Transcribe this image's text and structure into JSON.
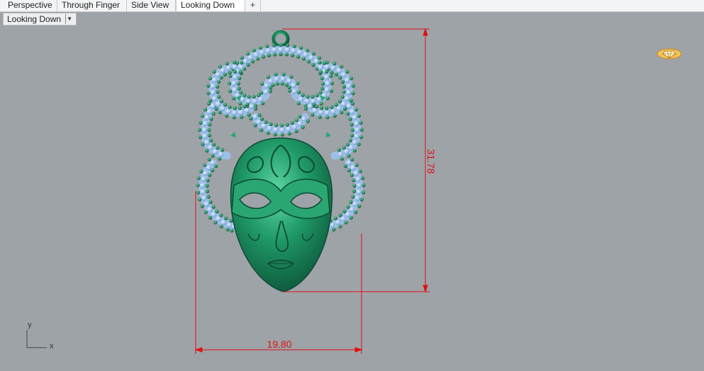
{
  "tabs": [
    {
      "label": "Perspective",
      "active": false
    },
    {
      "label": "Through Finger",
      "active": false
    },
    {
      "label": "Side View",
      "active": false
    },
    {
      "label": "Looking Down",
      "active": true
    }
  ],
  "add_tab_icon": "plus-icon",
  "viewport": {
    "title": "Looking Down",
    "menu_icon": "chevron-down-icon",
    "background_color": "#9ea3a8"
  },
  "dimensions": {
    "height_value": "31.78",
    "width_value": "19.80",
    "color": "#e01010"
  },
  "axes": {
    "x": "x",
    "y": "y"
  },
  "model": {
    "metal_color": "#1f8a60",
    "gem_color": "#9ec0ea"
  },
  "logo_icon": "gem-logo-icon"
}
